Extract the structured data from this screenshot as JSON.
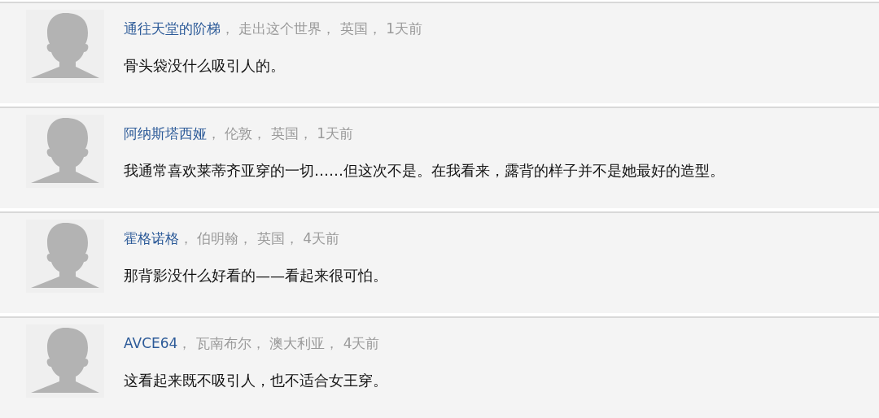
{
  "comments": [
    {
      "author": "通往天堂的阶梯",
      "meta": "， 走出这个世界， 英国， 1天前",
      "text": "骨头袋没什么吸引人的。"
    },
    {
      "author": "阿纳斯塔西娅",
      "meta": "， 伦敦， 英国， 1天前",
      "text": "我通常喜欢莱蒂齐亚穿的一切……但这次不是。在我看来，露背的样子并不是她最好的造型。"
    },
    {
      "author": "霍格诺格",
      "meta": "， 伯明翰， 英国， 4天前",
      "text": "那背影没什么好看的——看起来很可怕。"
    },
    {
      "author": "AVCE64",
      "meta": "， 瓦南布尔， 澳大利亚， 4天前",
      "text": "这看起来既不吸引人，也不适合女王穿。"
    }
  ]
}
